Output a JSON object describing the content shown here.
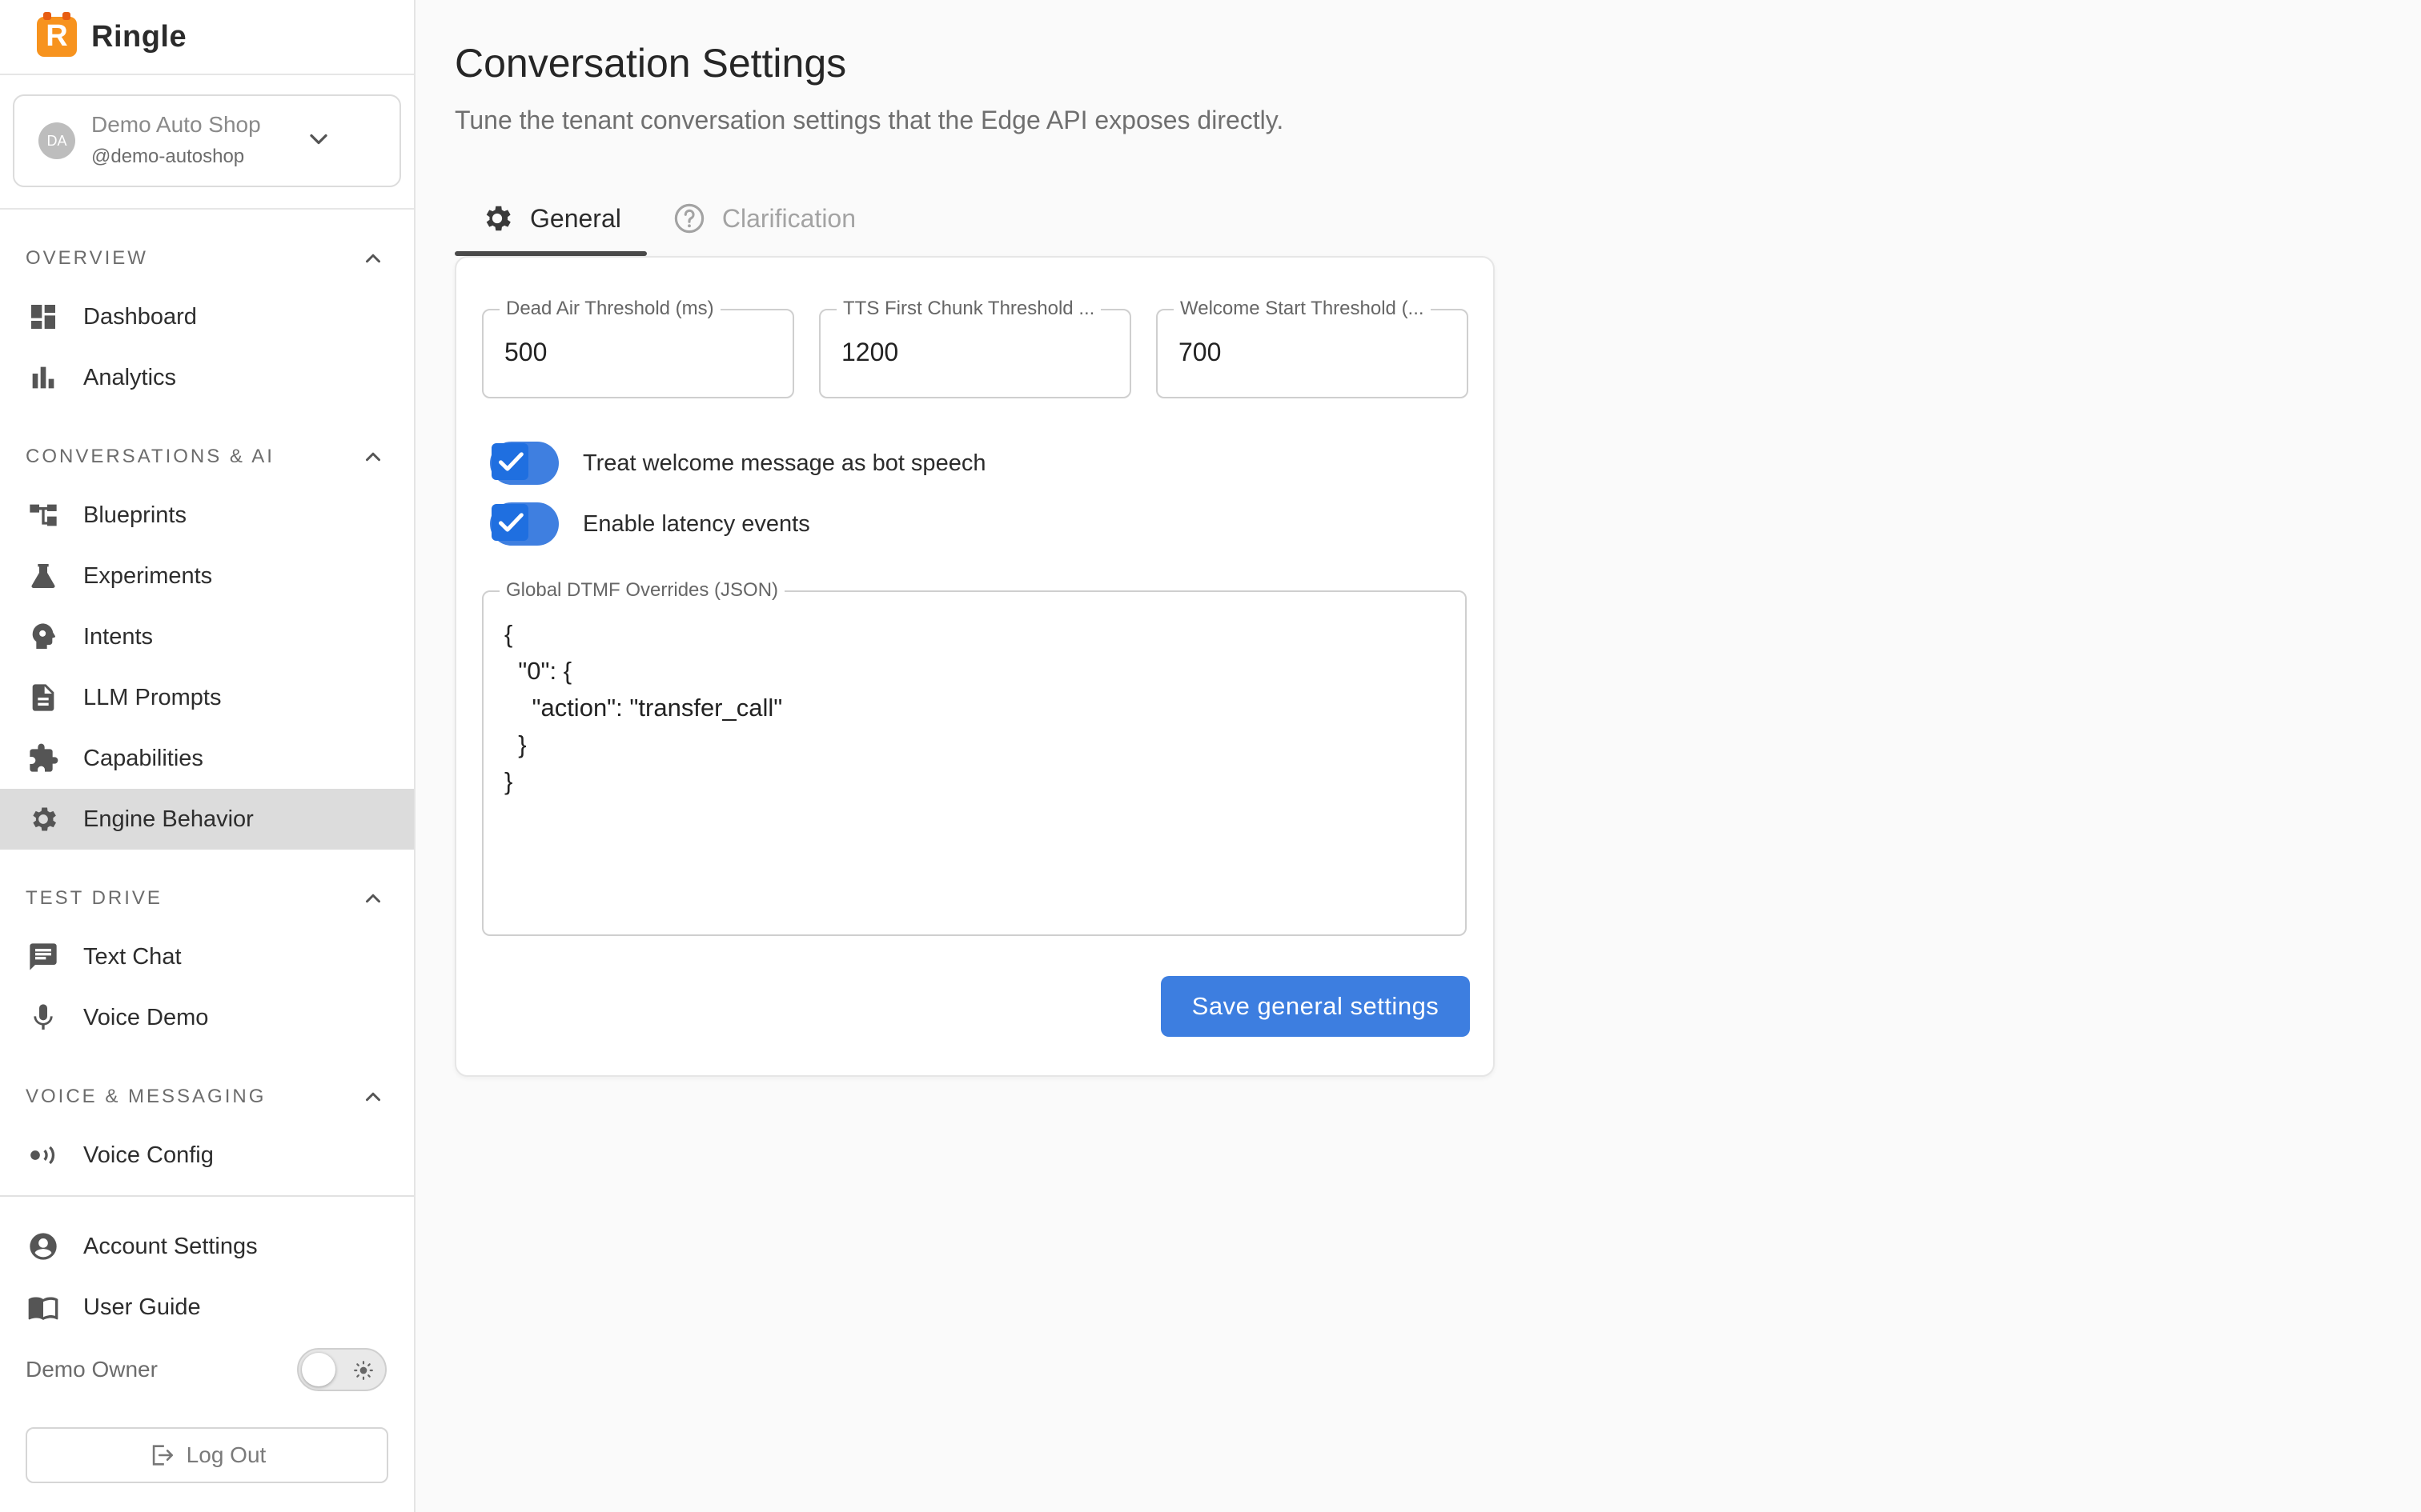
{
  "brand": {
    "logo_letter": "R",
    "name": "Ringle"
  },
  "tenant": {
    "initials": "DA",
    "name": "Demo Auto Shop",
    "handle": "@demo-autoshop"
  },
  "sections": [
    {
      "title": "OVERVIEW",
      "items": [
        {
          "label": "Dashboard",
          "icon": "dashboard-icon"
        },
        {
          "label": "Analytics",
          "icon": "analytics-icon"
        }
      ]
    },
    {
      "title": "CONVERSATIONS & AI",
      "items": [
        {
          "label": "Blueprints",
          "icon": "blueprints-icon"
        },
        {
          "label": "Experiments",
          "icon": "flask-icon"
        },
        {
          "label": "Intents",
          "icon": "intents-icon"
        },
        {
          "label": "LLM Prompts",
          "icon": "document-icon"
        },
        {
          "label": "Capabilities",
          "icon": "puzzle-icon"
        },
        {
          "label": "Engine Behavior",
          "icon": "gear-icon",
          "active": true
        }
      ]
    },
    {
      "title": "TEST DRIVE",
      "items": [
        {
          "label": "Text Chat",
          "icon": "chat-icon"
        },
        {
          "label": "Voice Demo",
          "icon": "mic-icon"
        }
      ]
    },
    {
      "title": "VOICE & MESSAGING",
      "items": [
        {
          "label": "Voice Config",
          "icon": "voice-config-icon"
        }
      ]
    }
  ],
  "bottom": {
    "account_settings": "Account Settings",
    "user_guide": "User Guide",
    "owner": "Demo Owner",
    "logout": "Log Out"
  },
  "page": {
    "title": "Conversation Settings",
    "subtitle": "Tune the tenant conversation settings that the Edge API exposes directly."
  },
  "tabs": [
    {
      "label": "General",
      "icon": "gear-icon",
      "active": true
    },
    {
      "label": "Clarification",
      "icon": "help-circle-icon",
      "active": false
    }
  ],
  "form": {
    "dead_air": {
      "label": "Dead Air Threshold (ms)",
      "value": "500"
    },
    "tts_first_chunk": {
      "label": "TTS First Chunk Threshold ...",
      "value": "1200"
    },
    "welcome_start": {
      "label": "Welcome Start Threshold (...",
      "value": "700"
    },
    "treat_welcome": {
      "label": "Treat welcome message as bot speech",
      "checked": true
    },
    "latency_events": {
      "label": "Enable latency events",
      "checked": true
    },
    "dtmf": {
      "label": "Global DTMF Overrides (JSON)",
      "value": "{\n  \"0\": {\n    \"action\": \"transfer_call\"\n  }\n}"
    },
    "save_label": "Save general settings"
  },
  "colors": {
    "accent": "#3d7ee0",
    "active_nav": "#dcdcdc",
    "brand": "#f7931e"
  }
}
